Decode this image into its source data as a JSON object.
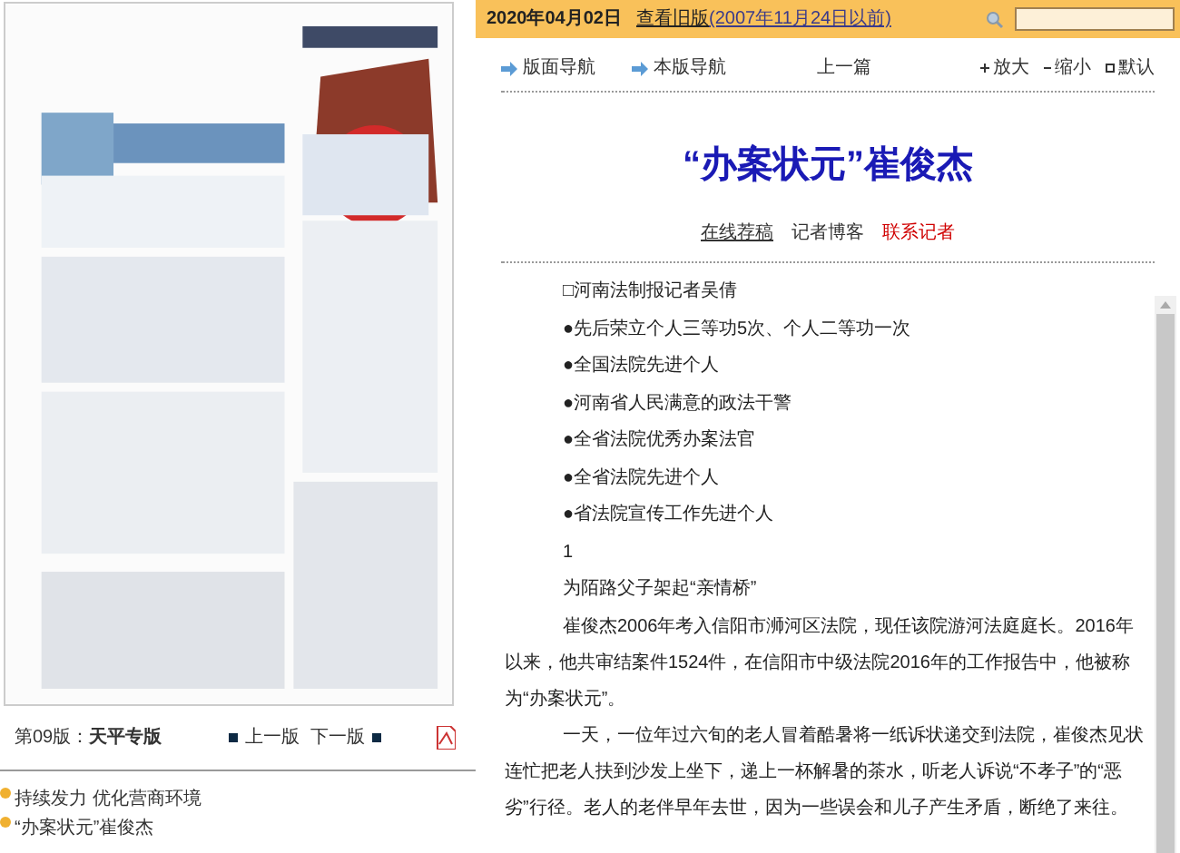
{
  "page_view": {
    "page_label": "第09版：**天平专版**",
    "prev_page": "上一版",
    "next_page": "下一版"
  },
  "articles": [
    {
      "title": "持续发力 优化营商环境"
    },
    {
      "title": "“办案状元”崔俊杰"
    }
  ],
  "top_bar": {
    "date": "2020年04月02日",
    "old_edition": "查看旧版",
    "old_edition_range": "(2007年11月24日以前)"
  },
  "nav": {
    "items": [
      {
        "label": "版面导航",
        "kind": "arrow"
      },
      {
        "label": "本版导航",
        "kind": "arrow"
      },
      {
        "label": "上一篇",
        "kind": "plain"
      }
    ],
    "font_tools": [
      {
        "label": "放大",
        "kind": "plus"
      },
      {
        "label": "缩小",
        "kind": "minus"
      },
      {
        "label": "默认",
        "kind": "square"
      }
    ]
  },
  "article": {
    "title": "“办案状元”崔俊杰",
    "links": [
      {
        "label": "在线荐稿",
        "kind": "underlined"
      },
      {
        "label": "记者博客",
        "kind": "plain"
      },
      {
        "label": "联系记者",
        "kind": "alert"
      }
    ],
    "body": [
      {
        "kind": "line",
        "text": "□河南法制报记者吴倩"
      },
      {
        "kind": "line",
        "text": "●先后荣立个人三等功5次、个人二等功一次"
      },
      {
        "kind": "line",
        "text": "●全国法院先进个人"
      },
      {
        "kind": "line",
        "text": "●河南省人民满意的政法干警"
      },
      {
        "kind": "line",
        "text": "●全省法院优秀办案法官"
      },
      {
        "kind": "line",
        "text": "●全省法院先进个人"
      },
      {
        "kind": "line",
        "text": "●省法院宣传工作先进个人"
      },
      {
        "kind": "line",
        "text": "1"
      },
      {
        "kind": "heading",
        "text": "为陌路父子架起“亲情桥”"
      },
      {
        "kind": "paragraph",
        "text": "崔俊杰2006年考入信阳市浉河区法院，现任该院游河法庭庭长。2016年以来，他共审结案件1524件，在信阳市中级法院2016年的工作报告中，他被称为“办案状元”。"
      },
      {
        "kind": "paragraph",
        "text": "一天，一位年过六旬的老人冒着酷暑将一纸诉状递交到法院，崔俊杰见状连忙把老人扶到沙发上坐下，递上一杯解暑的茶水，听老人诉说“不孝子”的“恶劣”行径。老人的老伴早年去世，因为一些误会和儿子产生矛盾，断绝了来往。"
      }
    ]
  }
}
